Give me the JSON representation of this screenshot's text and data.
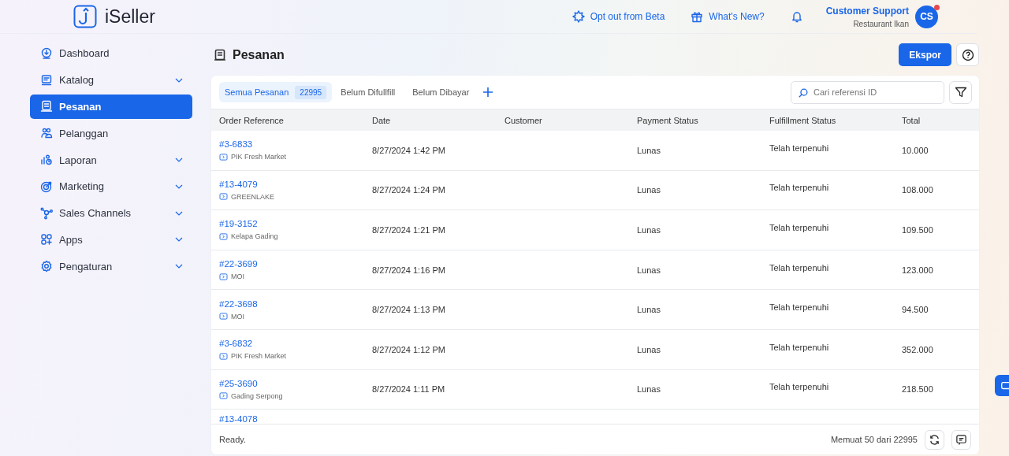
{
  "brand": {
    "name": "iSeller"
  },
  "topbar": {
    "links": [
      {
        "kind": "beta",
        "label": "Opt out from Beta"
      },
      {
        "kind": "gift",
        "label": "What's New?"
      }
    ],
    "user": {
      "name": "Customer Support",
      "store": "Restaurant Ikan",
      "initials": "CS",
      "has_notification": true
    }
  },
  "sidebar": {
    "items": [
      {
        "label": "Dashboard",
        "selected": false,
        "expandable": false
      },
      {
        "label": "Katalog",
        "selected": false,
        "expandable": true
      },
      {
        "label": "Pesanan",
        "selected": true,
        "expandable": false
      },
      {
        "label": "Pelanggan",
        "selected": false,
        "expandable": false
      },
      {
        "label": "Laporan",
        "selected": false,
        "expandable": true
      },
      {
        "label": "Marketing",
        "selected": false,
        "expandable": true
      },
      {
        "label": "Sales Channels",
        "selected": false,
        "expandable": true
      },
      {
        "label": "Apps",
        "selected": false,
        "expandable": true
      },
      {
        "label": "Pengaturan",
        "selected": false,
        "expandable": true
      }
    ]
  },
  "page": {
    "title": "Pesanan",
    "export_button": "Ekspor"
  },
  "tabs": [
    {
      "label": "Semua Pesanan",
      "count": "22995",
      "selected": true
    },
    {
      "label": "Belum Difullfill",
      "selected": false
    },
    {
      "label": "Belum Dibayar",
      "selected": false
    }
  ],
  "search": {
    "placeholder": "Cari referensi ID"
  },
  "table": {
    "columns": [
      "Order Reference",
      "Date",
      "Customer",
      "Payment Status",
      "Fulfillment Status",
      "Total"
    ],
    "rows": [
      {
        "reference": "#3-6833",
        "store": "PIK Fresh Market",
        "date": "8/27/2024 1:42 PM",
        "payment": "Lunas",
        "fulfillment": "Telah terpenuhi",
        "total": "10.000"
      },
      {
        "reference": "#13-4079",
        "store": "GREENLAKE",
        "date": "8/27/2024 1:24 PM",
        "payment": "Lunas",
        "fulfillment": "Telah terpenuhi",
        "total": "108.000"
      },
      {
        "reference": "#19-3152",
        "store": "Kelapa Gading",
        "date": "8/27/2024 1:21 PM",
        "payment": "Lunas",
        "fulfillment": "Telah terpenuhi",
        "total": "109.500"
      },
      {
        "reference": "#22-3699",
        "store": "MOI",
        "date": "8/27/2024 1:16 PM",
        "payment": "Lunas",
        "fulfillment": "Telah terpenuhi",
        "total": "123.000"
      },
      {
        "reference": "#22-3698",
        "store": "MOI",
        "date": "8/27/2024 1:13 PM",
        "payment": "Lunas",
        "fulfillment": "Telah terpenuhi",
        "total": "94.500"
      },
      {
        "reference": "#3-6832",
        "store": "PIK Fresh Market",
        "date": "8/27/2024 1:12 PM",
        "payment": "Lunas",
        "fulfillment": "Telah terpenuhi",
        "total": "352.000"
      },
      {
        "reference": "#25-3690",
        "store": "Gading Serpong",
        "date": "8/27/2024 1:11 PM",
        "payment": "Lunas",
        "fulfillment": "Telah terpenuhi",
        "total": "218.500"
      },
      {
        "reference": "#13-4078"
      }
    ]
  },
  "footer": {
    "status": "Ready.",
    "loaded": "Memuat 50 dari 22995"
  }
}
